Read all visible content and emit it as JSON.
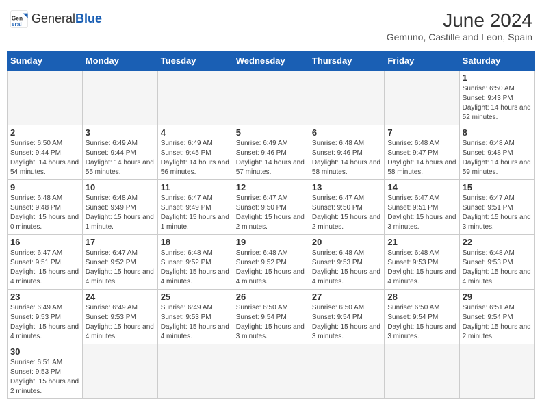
{
  "header": {
    "logo_general": "General",
    "logo_blue": "Blue",
    "month_title": "June 2024",
    "location": "Gemuno, Castille and Leon, Spain"
  },
  "days_of_week": [
    "Sunday",
    "Monday",
    "Tuesday",
    "Wednesday",
    "Thursday",
    "Friday",
    "Saturday"
  ],
  "weeks": [
    [
      {
        "day": "",
        "info": ""
      },
      {
        "day": "",
        "info": ""
      },
      {
        "day": "",
        "info": ""
      },
      {
        "day": "",
        "info": ""
      },
      {
        "day": "",
        "info": ""
      },
      {
        "day": "",
        "info": ""
      },
      {
        "day": "1",
        "info": "Sunrise: 6:50 AM\nSunset: 9:43 PM\nDaylight: 14 hours and 52 minutes."
      }
    ],
    [
      {
        "day": "2",
        "info": "Sunrise: 6:50 AM\nSunset: 9:44 PM\nDaylight: 14 hours and 54 minutes."
      },
      {
        "day": "3",
        "info": "Sunrise: 6:49 AM\nSunset: 9:44 PM\nDaylight: 14 hours and 55 minutes."
      },
      {
        "day": "4",
        "info": "Sunrise: 6:49 AM\nSunset: 9:45 PM\nDaylight: 14 hours and 56 minutes."
      },
      {
        "day": "5",
        "info": "Sunrise: 6:49 AM\nSunset: 9:46 PM\nDaylight: 14 hours and 57 minutes."
      },
      {
        "day": "6",
        "info": "Sunrise: 6:48 AM\nSunset: 9:46 PM\nDaylight: 14 hours and 58 minutes."
      },
      {
        "day": "7",
        "info": "Sunrise: 6:48 AM\nSunset: 9:47 PM\nDaylight: 14 hours and 58 minutes."
      },
      {
        "day": "8",
        "info": "Sunrise: 6:48 AM\nSunset: 9:48 PM\nDaylight: 14 hours and 59 minutes."
      }
    ],
    [
      {
        "day": "9",
        "info": "Sunrise: 6:48 AM\nSunset: 9:48 PM\nDaylight: 15 hours and 0 minutes."
      },
      {
        "day": "10",
        "info": "Sunrise: 6:48 AM\nSunset: 9:49 PM\nDaylight: 15 hours and 1 minute."
      },
      {
        "day": "11",
        "info": "Sunrise: 6:47 AM\nSunset: 9:49 PM\nDaylight: 15 hours and 1 minute."
      },
      {
        "day": "12",
        "info": "Sunrise: 6:47 AM\nSunset: 9:50 PM\nDaylight: 15 hours and 2 minutes."
      },
      {
        "day": "13",
        "info": "Sunrise: 6:47 AM\nSunset: 9:50 PM\nDaylight: 15 hours and 2 minutes."
      },
      {
        "day": "14",
        "info": "Sunrise: 6:47 AM\nSunset: 9:51 PM\nDaylight: 15 hours and 3 minutes."
      },
      {
        "day": "15",
        "info": "Sunrise: 6:47 AM\nSunset: 9:51 PM\nDaylight: 15 hours and 3 minutes."
      }
    ],
    [
      {
        "day": "16",
        "info": "Sunrise: 6:47 AM\nSunset: 9:51 PM\nDaylight: 15 hours and 4 minutes."
      },
      {
        "day": "17",
        "info": "Sunrise: 6:47 AM\nSunset: 9:52 PM\nDaylight: 15 hours and 4 minutes."
      },
      {
        "day": "18",
        "info": "Sunrise: 6:48 AM\nSunset: 9:52 PM\nDaylight: 15 hours and 4 minutes."
      },
      {
        "day": "19",
        "info": "Sunrise: 6:48 AM\nSunset: 9:52 PM\nDaylight: 15 hours and 4 minutes."
      },
      {
        "day": "20",
        "info": "Sunrise: 6:48 AM\nSunset: 9:53 PM\nDaylight: 15 hours and 4 minutes."
      },
      {
        "day": "21",
        "info": "Sunrise: 6:48 AM\nSunset: 9:53 PM\nDaylight: 15 hours and 4 minutes."
      },
      {
        "day": "22",
        "info": "Sunrise: 6:48 AM\nSunset: 9:53 PM\nDaylight: 15 hours and 4 minutes."
      }
    ],
    [
      {
        "day": "23",
        "info": "Sunrise: 6:49 AM\nSunset: 9:53 PM\nDaylight: 15 hours and 4 minutes."
      },
      {
        "day": "24",
        "info": "Sunrise: 6:49 AM\nSunset: 9:53 PM\nDaylight: 15 hours and 4 minutes."
      },
      {
        "day": "25",
        "info": "Sunrise: 6:49 AM\nSunset: 9:53 PM\nDaylight: 15 hours and 4 minutes."
      },
      {
        "day": "26",
        "info": "Sunrise: 6:50 AM\nSunset: 9:54 PM\nDaylight: 15 hours and 3 minutes."
      },
      {
        "day": "27",
        "info": "Sunrise: 6:50 AM\nSunset: 9:54 PM\nDaylight: 15 hours and 3 minutes."
      },
      {
        "day": "28",
        "info": "Sunrise: 6:50 AM\nSunset: 9:54 PM\nDaylight: 15 hours and 3 minutes."
      },
      {
        "day": "29",
        "info": "Sunrise: 6:51 AM\nSunset: 9:54 PM\nDaylight: 15 hours and 2 minutes."
      }
    ],
    [
      {
        "day": "30",
        "info": "Sunrise: 6:51 AM\nSunset: 9:53 PM\nDaylight: 15 hours and 2 minutes."
      },
      {
        "day": "",
        "info": ""
      },
      {
        "day": "",
        "info": ""
      },
      {
        "day": "",
        "info": ""
      },
      {
        "day": "",
        "info": ""
      },
      {
        "day": "",
        "info": ""
      },
      {
        "day": "",
        "info": ""
      }
    ]
  ]
}
